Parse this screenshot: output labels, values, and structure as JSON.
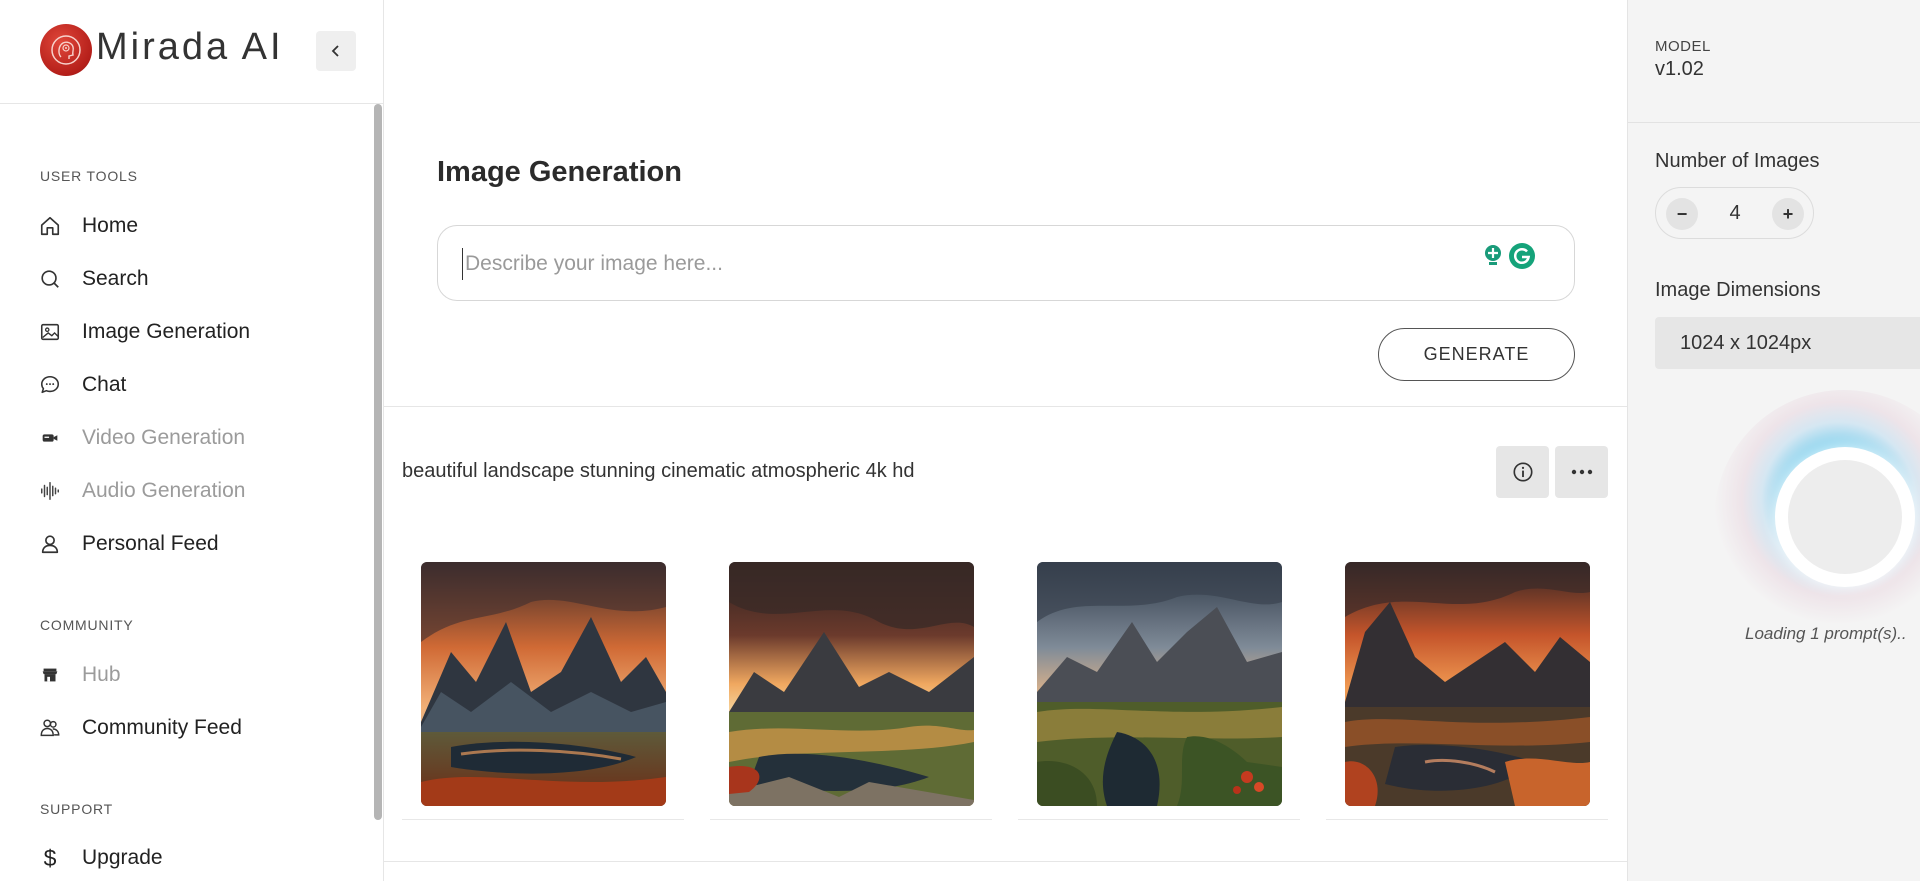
{
  "brand": {
    "name": "Mirada AI"
  },
  "sidebar": {
    "sections": [
      {
        "label": "USER TOOLS"
      },
      {
        "label": "COMMUNITY"
      },
      {
        "label": "SUPPORT"
      }
    ],
    "items": [
      {
        "label": "Home",
        "icon": "home-icon",
        "disabled": false
      },
      {
        "label": "Search",
        "icon": "search-icon",
        "disabled": false
      },
      {
        "label": "Image Generation",
        "icon": "image-icon",
        "disabled": false
      },
      {
        "label": "Chat",
        "icon": "chat-icon",
        "disabled": false
      },
      {
        "label": "Video Generation",
        "icon": "video-icon",
        "disabled": true
      },
      {
        "label": "Audio Generation",
        "icon": "audio-waveform-icon",
        "disabled": true
      },
      {
        "label": "Personal Feed",
        "icon": "user-icon",
        "disabled": false
      },
      {
        "label": "Hub",
        "icon": "store-icon",
        "disabled": true
      },
      {
        "label": "Community Feed",
        "icon": "users-icon",
        "disabled": false
      },
      {
        "label": "Upgrade",
        "icon": "dollar-icon",
        "disabled": false
      }
    ]
  },
  "main": {
    "title": "Image Generation",
    "prompt": {
      "value": "",
      "placeholder": "Describe your image here..."
    },
    "generate_label": "GENERATE",
    "result": {
      "prompt_text": "beautiful landscape stunning cinematic atmospheric 4k hd",
      "images": [
        {
          "alt": "mountain lake landscape 1"
        },
        {
          "alt": "mountain lake landscape 2"
        },
        {
          "alt": "mountain lake landscape 3"
        },
        {
          "alt": "mountain lake landscape 4"
        }
      ]
    }
  },
  "right_panel": {
    "model_label": "MODEL",
    "model_value": "v1.02",
    "num_images_label": "Number of Images",
    "num_images_value": "4",
    "minus_label": "−",
    "plus_label": "+",
    "dimensions_label": "Image Dimensions",
    "dimensions_value": "1024 x 1024px",
    "loading_text": "Loading 1 prompt(s).."
  },
  "colors": {
    "brand_red": "#c8281f",
    "accent_cyan": "#4dcee8",
    "disabled_text": "#9b9b9b"
  }
}
